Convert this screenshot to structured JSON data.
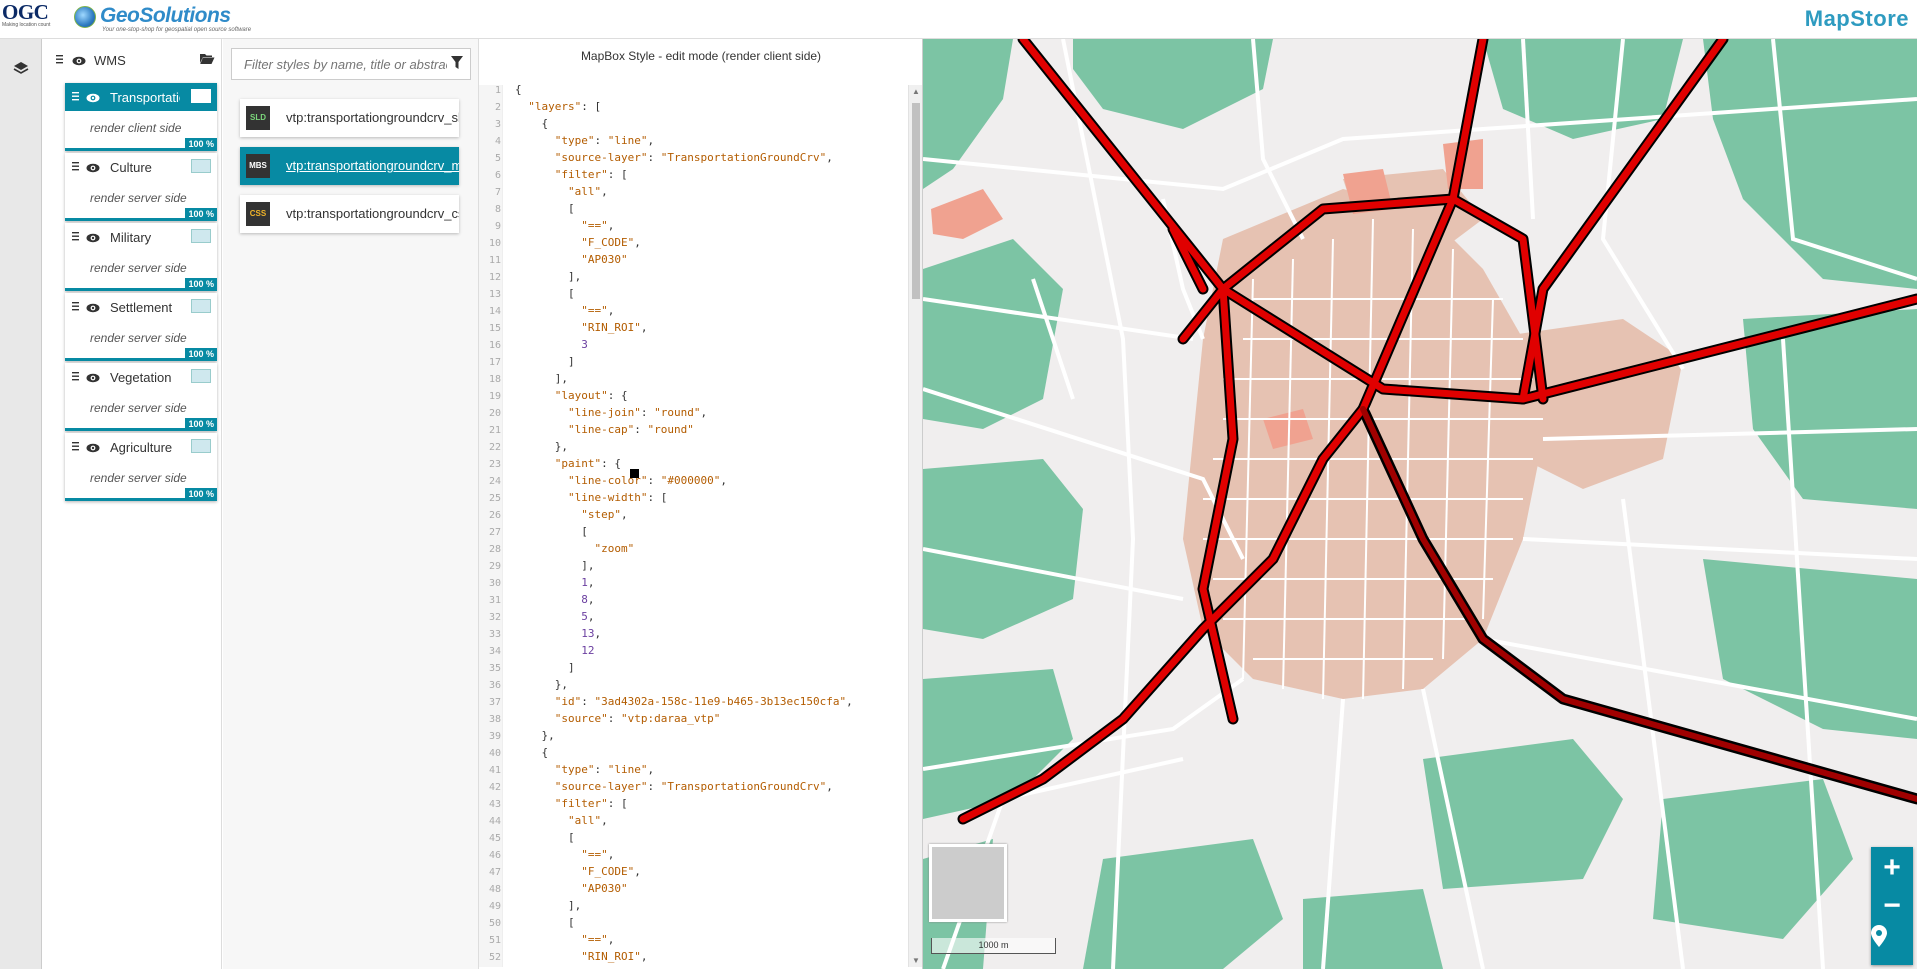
{
  "header": {
    "ogc_logo_text": "OGC",
    "ogc_logo_sub": "Making location count",
    "geo_name": "GeoSolutions",
    "geo_tagline": "Your one-stop-shop for geospatial open source software",
    "app_name": "MapStore"
  },
  "toc": {
    "group_name": "WMS",
    "layers": [
      {
        "name": "Transportation",
        "render": "render client side",
        "opacity": "100 %",
        "selected": true
      },
      {
        "name": "Culture",
        "render": "render server side",
        "opacity": "100 %"
      },
      {
        "name": "Military",
        "render": "render server side",
        "opacity": "100 %"
      },
      {
        "name": "Settlement",
        "render": "render server side",
        "opacity": "100 %"
      },
      {
        "name": "Vegetation",
        "render": "render server side",
        "opacity": "100 %"
      },
      {
        "name": "Agriculture",
        "render": "render server side",
        "opacity": "100 %"
      }
    ]
  },
  "styles": {
    "filter_placeholder": "Filter styles by name, title or abstract",
    "items": [
      {
        "format": "SLD",
        "name": "vtp:transportationgroundcrv_sld"
      },
      {
        "format": "MBS",
        "name": "vtp:transportationgroundcrv_mbs",
        "selected": true
      },
      {
        "format": "CSS",
        "name": "vtp:transportationgroundcrv_css"
      }
    ]
  },
  "editor": {
    "title": "MapBox Style - edit mode (render client side)",
    "lines": [
      "{",
      "  \"layers\": [",
      "    {",
      "      \"type\": \"line\",",
      "      \"source-layer\": \"TransportationGroundCrv\",",
      "      \"filter\": [",
      "        \"all\",",
      "        [",
      "          \"==\",",
      "          \"F_CODE\",",
      "          \"AP030\"",
      "        ],",
      "        [",
      "          \"==\",",
      "          \"RIN_ROI\",",
      "          3",
      "        ]",
      "      ],",
      "      \"layout\": {",
      "        \"line-join\": \"round\",",
      "        \"line-cap\": \"round\"",
      "      },",
      "      \"paint\": {",
      "        \"line-color\": \"#000000\",",
      "        \"line-width\": [",
      "          \"step\",",
      "          [",
      "            \"zoom\"",
      "          ],",
      "          1,",
      "          8,",
      "          5,",
      "          13,",
      "          12",
      "        ]",
      "      },",
      "      \"id\": \"3ad4302a-158c-11e9-b465-3b13ec150cfa\",",
      "      \"source\": \"vtp:daraa_vtp\"",
      "    },",
      "    {",
      "      \"type\": \"line\",",
      "      \"source-layer\": \"TransportationGroundCrv\",",
      "      \"filter\": [",
      "        \"all\",",
      "        [",
      "          \"==\",",
      "          \"F_CODE\",",
      "          \"AP030\"",
      "        ],",
      "        [",
      "          \"==\",",
      "          \"RIN_ROI\","
    ]
  },
  "map": {
    "scale_label": "1000 m",
    "zoom_in": "+",
    "zoom_out": "−"
  },
  "colors": {
    "accent": "#078aa3",
    "road_primary": "#e00000",
    "vegetation": "#7cc4a4",
    "urban": "#e8c4b4"
  }
}
